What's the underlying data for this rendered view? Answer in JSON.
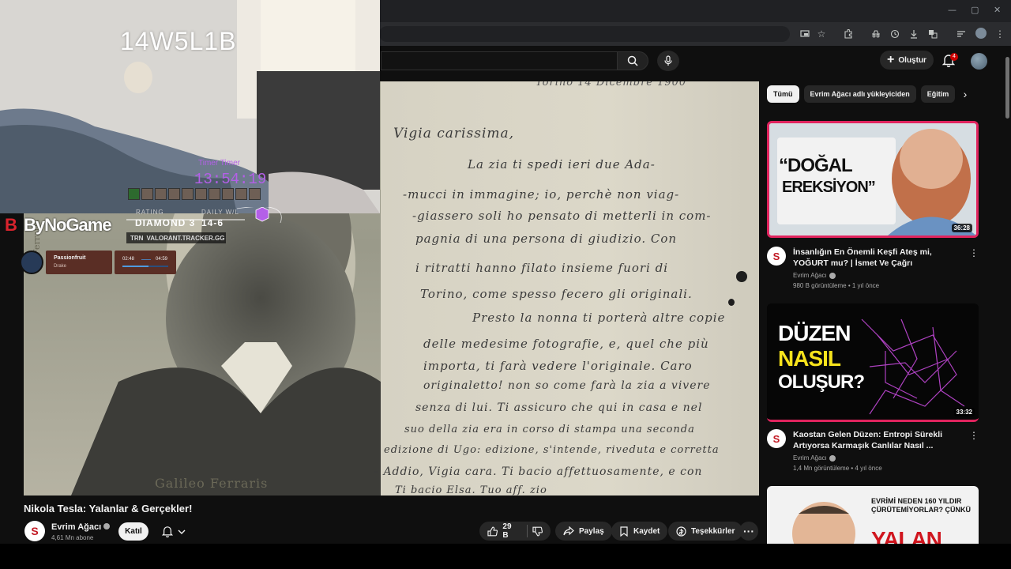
{
  "colors": {
    "bg": "#0f0f0f",
    "accent_red": "#cc0000",
    "brand_red": "#c21823",
    "overlay_purple": "#b45fe8"
  },
  "browser": {
    "window_controls": [
      "—",
      "▢",
      "✕"
    ],
    "toolbar_icons": [
      "cast-icon",
      "star-icon",
      "extensions-icon",
      "incognito-icon",
      "history-icon",
      "download-icon",
      "translate-icon",
      "reading-list-icon",
      "profile-icon",
      "more-icon"
    ]
  },
  "header": {
    "create_label": "Oluştur",
    "notification_count": "4"
  },
  "stream_overlay": {
    "code": "14W5L1B",
    "timer_label": "Timer Timer",
    "timer": "13:54:19",
    "rating_label": "RATING",
    "rating_value": "DIAMOND 3",
    "daily_label": "DAILY W/L",
    "daily_value": "14-6",
    "tracker_brand": "TRN",
    "tracker_url": "VALORANT.TRACKER.GG",
    "logo_mark": "B",
    "logo_text": "ByNoGame",
    "track_title": "Passionfruit",
    "track_artist": "Drake",
    "track_elapsed": "02:48",
    "track_total": "04:59"
  },
  "video": {
    "caption": "Galileo Ferraris",
    "letter_lines": [
      "Torino 14 Dicembre 1900",
      "Vigia carissima,",
      "La zia ti spedi ieri due Ada-",
      "-mucci in immagine; io, perchè non viag-",
      "-giassero soli ho pensato di metterli in com-",
      "pagnia di una persona di giudizio. Con",
      "i ritratti hanno filato insieme fuori di",
      "Torino, come spesso fecero gli originali.",
      "Presto la nonna ti porterà altre copie",
      "delle medesime fotografie, e, quel che più",
      "importa, ti farà vedere l'originale. Caro",
      "originaletto! non so come farà la zia a vivere",
      "senza di lui. Ti assicuro che qui in casa e nel",
      "suo della zia era in corso di stampa una seconda",
      "edizione di Ugo: edizione, s'intende, riveduta e corretta",
      "– Addio, Vigia cara. Ti bacio affettuosamente, e con",
      "Ti bacio Elsa. Tuo aff. zio"
    ],
    "title": "Nikola Tesla: Yalanlar & Gerçekler!"
  },
  "channel": {
    "avatar_letter": "S",
    "name": "Evrim Ağacı",
    "subscribers": "4,61 Mn abone",
    "join_label": "Katıl"
  },
  "actions": {
    "likes": "29 B",
    "share": "Paylaş",
    "save": "Kaydet",
    "thanks": "Teşekkürler"
  },
  "chips": [
    "Tümü",
    "Evrim Ağacı adlı yükleyiciden",
    "Eğitim"
  ],
  "recommendations": [
    {
      "thumb_text_1": "“DOĞAL",
      "thumb_text_2": "EREKSİYON”",
      "duration": "36:28",
      "title": "İnsanlığın En Önemli Keşfi Ateş mi, YOĞURT mu? | İsmet Ve Çağrı",
      "channel": "Evrim Ağacı",
      "meta": "980 B görüntüleme • 1 yıl önce"
    },
    {
      "thumb_text_1": "DÜZEN",
      "thumb_text_2": "NASIL",
      "thumb_text_3": "OLUŞUR?",
      "duration": "33:32",
      "title": "Kaostan Gelen Düzen: Entropi Sürekli Artıyorsa Karmaşık Canlılar Nasıl ...",
      "channel": "Evrim Ağacı",
      "meta": "1,4 Mn görüntüleme • 4 yıl önce"
    },
    {
      "thumb_text_1": "EVRİMİ NEDEN 160 YILDIR",
      "thumb_text_2": "ÇÜRÜTEMİYORLAR? ÇÜNKÜ",
      "thumb_text_3": "YALAN"
    }
  ]
}
